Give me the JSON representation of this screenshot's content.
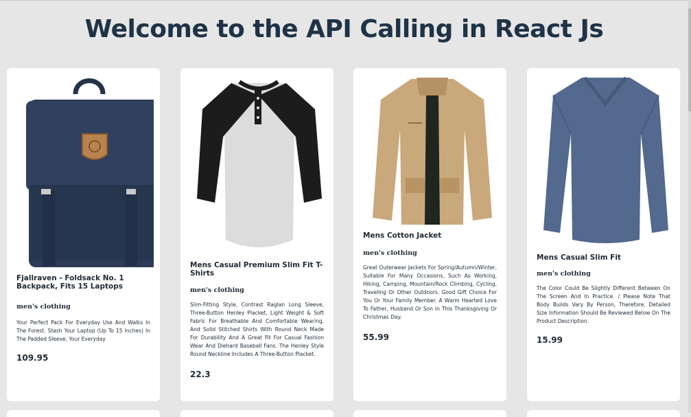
{
  "page": {
    "heading": "Welcome to the API Calling in React Js"
  },
  "products": [
    {
      "image": "backpack",
      "title": "Fjallraven - Foldsack No. 1 Backpack, Fits 15 Laptops",
      "category": "men's clothing",
      "description": "Your Perfect Pack For Everyday Use And Walks In The Forest. Stash Your Laptop (Up To 15 Inches) In The Padded Sleeve, Your Everyday",
      "price": "109.95"
    },
    {
      "image": "raglan-shirt",
      "title": "Mens Casual Premium Slim Fit T-Shirts",
      "category": "men's clothing",
      "description": "Slim-Fitting Style, Contrast Raglan Long Sleeve, Three-Button Henley Placket, Light Weight & Soft Fabric For Breathable And Comfortable Wearing. And Solid Stitched Shirts With Round Neck Made For Durability And A Great Fit For Casual Fashion Wear And Diehard Baseball Fans. The Henley Style Round Neckline Includes A Three-Button Placket.",
      "price": "22.3"
    },
    {
      "image": "cotton-jacket",
      "title": "Mens Cotton Jacket",
      "category": "men's clothing",
      "description": "Great Outerwear Jackets For Spring/Autumn/Winter, Suitable For Many Occasions, Such As Working, Hiking, Camping, Mountain/Rock Climbing, Cycling, Traveling Or Other Outdoors. Good Gift Choice For You Or Your Family Member. A Warm Hearted Love To Father, Husband Or Son In This Thanksgiving Or Christmas Day.",
      "price": "55.99"
    },
    {
      "image": "slim-fit-shirt",
      "title": "Mens Casual Slim Fit",
      "category": "men's clothing",
      "description": "The Color Could Be Slightly Different Between On The Screen And In Practice. / Please Note That Body Builds Vary By Person, Therefore, Detailed Size Information Should Be Reviewed Below On The Product Description.",
      "price": "15.99"
    }
  ],
  "colors": {
    "background": "#e6e6e6",
    "heading": "#1f3347",
    "card": "#ffffff"
  }
}
